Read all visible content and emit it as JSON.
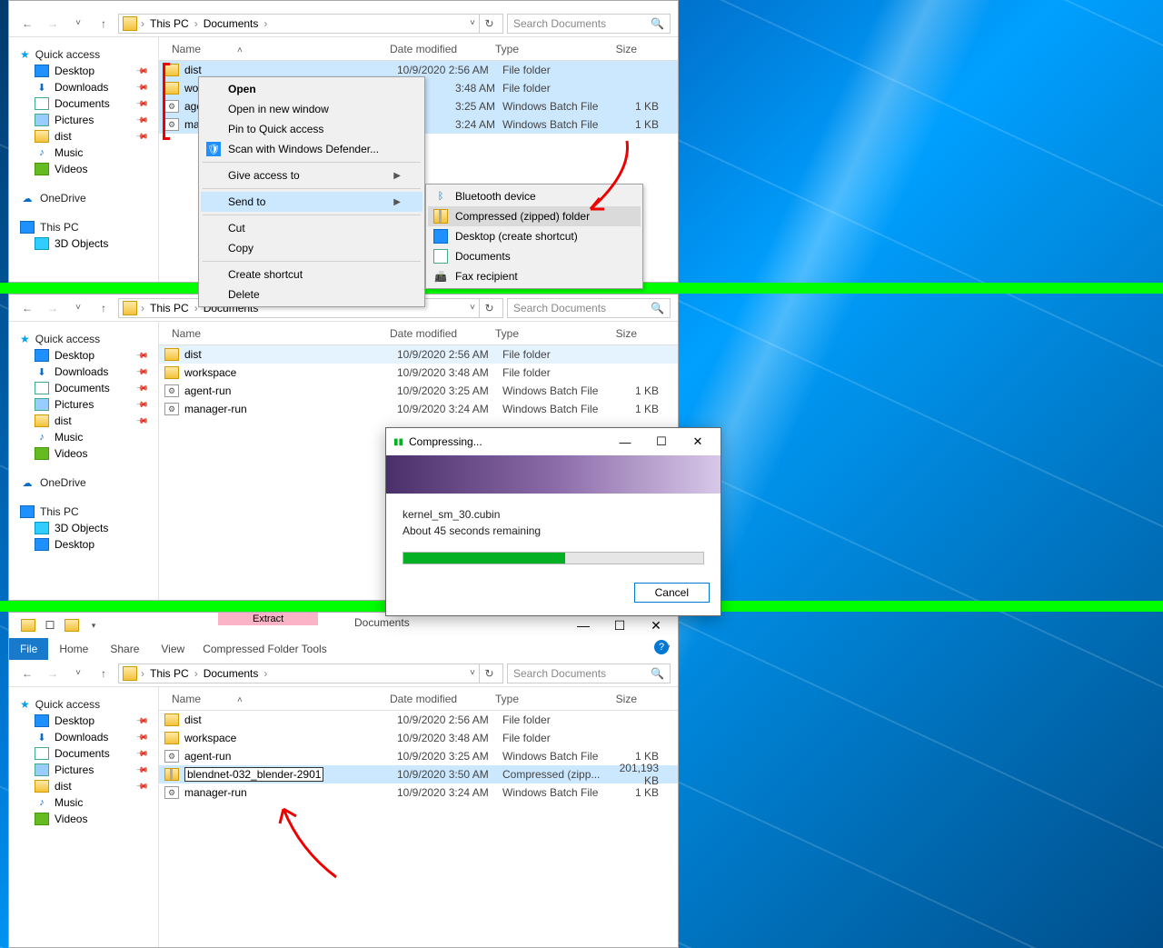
{
  "sidebar": {
    "quick_access": "Quick access",
    "items": [
      {
        "label": "Desktop",
        "pinned": true,
        "icon": "desktop"
      },
      {
        "label": "Downloads",
        "pinned": true,
        "icon": "downloads"
      },
      {
        "label": "Documents",
        "pinned": true,
        "icon": "documents"
      },
      {
        "label": "Pictures",
        "pinned": true,
        "icon": "pictures"
      },
      {
        "label": "dist",
        "pinned": true,
        "icon": "folder"
      },
      {
        "label": "Music",
        "pinned": false,
        "icon": "music"
      },
      {
        "label": "Videos",
        "pinned": false,
        "icon": "videos"
      }
    ],
    "onedrive": "OneDrive",
    "this_pc": "This PC",
    "pc_items": [
      {
        "label": "3D Objects",
        "icon": "3d"
      },
      {
        "label": "Desktop",
        "icon": "desktop"
      }
    ]
  },
  "columns": {
    "name": "Name",
    "date": "Date modified",
    "type": "Type",
    "size": "Size"
  },
  "breadcrumb": {
    "root": "This PC",
    "folder": "Documents"
  },
  "search_placeholder": "Search Documents",
  "panel1": {
    "files": [
      {
        "name": "dist",
        "date": "10/9/2020 2:56 AM",
        "type": "File folder",
        "size": "",
        "icon": "folder",
        "sel": true
      },
      {
        "name": "workspace",
        "date_suffix": "3:48 AM",
        "type": "File folder",
        "size": "",
        "icon": "folder",
        "sel": true
      },
      {
        "name": "agent-run",
        "date_suffix": "3:25 AM",
        "type": "Windows Batch File",
        "size": "1 KB",
        "icon": "batch",
        "sel": true
      },
      {
        "name": "manager-run",
        "date_suffix": "3:24 AM",
        "type": "Windows Batch File",
        "size": "1 KB",
        "icon": "batch",
        "sel": true
      }
    ],
    "context_menu": {
      "open": "Open",
      "open_new": "Open in new window",
      "pin_qa": "Pin to Quick access",
      "scan_defender": "Scan with Windows Defender...",
      "give_access": "Give access to",
      "send_to": "Send to",
      "cut": "Cut",
      "copy": "Copy",
      "create_shortcut": "Create shortcut",
      "delete": "Delete"
    },
    "submenu": {
      "bluetooth": "Bluetooth device",
      "compressed": "Compressed (zipped) folder",
      "desktop_shortcut": "Desktop (create shortcut)",
      "documents": "Documents",
      "fax": "Fax recipient"
    }
  },
  "panel2": {
    "files": [
      {
        "name": "dist",
        "date": "10/9/2020 2:56 AM",
        "type": "File folder",
        "size": "",
        "icon": "folder"
      },
      {
        "name": "workspace",
        "date": "10/9/2020 3:48 AM",
        "type": "File folder",
        "size": "",
        "icon": "folder"
      },
      {
        "name": "agent-run",
        "date": "10/9/2020 3:25 AM",
        "type": "Windows Batch File",
        "size": "1 KB",
        "icon": "batch"
      },
      {
        "name": "manager-run",
        "date": "10/9/2020 3:24 AM",
        "type": "Windows Batch File",
        "size": "1 KB",
        "icon": "batch"
      }
    ],
    "dialog": {
      "title": "Compressing...",
      "line1": "kernel_sm_30.cubin",
      "line2": "About 45 seconds remaining",
      "progress_pct": 54,
      "cancel": "Cancel"
    }
  },
  "panel3": {
    "title": "Documents",
    "ribbon": {
      "file": "File",
      "home": "Home",
      "share": "Share",
      "view": "View",
      "extract": "Extract",
      "context_label": "Compressed Folder Tools"
    },
    "files": [
      {
        "name": "dist",
        "date": "10/9/2020 2:56 AM",
        "type": "File folder",
        "size": "",
        "icon": "folder"
      },
      {
        "name": "workspace",
        "date": "10/9/2020 3:48 AM",
        "type": "File folder",
        "size": "",
        "icon": "folder"
      },
      {
        "name": "agent-run",
        "date": "10/9/2020 3:25 AM",
        "type": "Windows Batch File",
        "size": "1 KB",
        "icon": "batch"
      },
      {
        "name": "blendnet-032_blender-2901",
        "date": "10/9/2020 3:50 AM",
        "type": "Compressed (zipp...",
        "size": "201,193 KB",
        "icon": "zip",
        "rename": true,
        "sel": true
      },
      {
        "name": "manager-run",
        "date": "10/9/2020 3:24 AM",
        "type": "Windows Batch File",
        "size": "1 KB",
        "icon": "batch"
      }
    ]
  }
}
